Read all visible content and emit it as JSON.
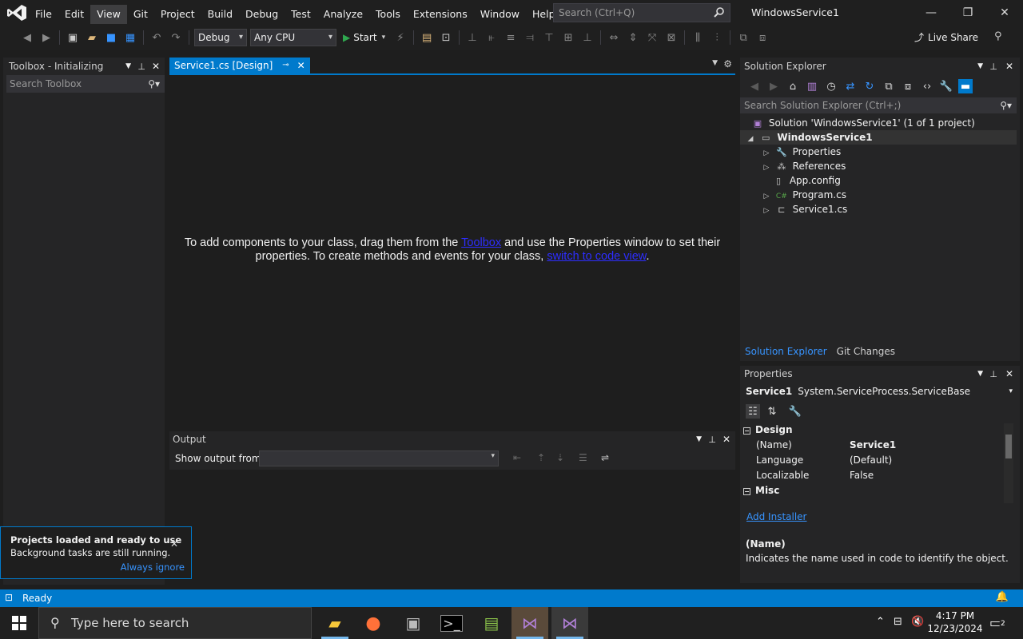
{
  "menu": [
    "File",
    "Edit",
    "View",
    "Git",
    "Project",
    "Build",
    "Debug",
    "Test",
    "Analyze",
    "Tools",
    "Extensions",
    "Window",
    "Help"
  ],
  "search_placeholder": "Search (Ctrl+Q)",
  "window_title": "WindowsService1",
  "toolbar": {
    "config": "Debug",
    "platform": "Any CPU",
    "start": "Start",
    "live_share": "Live Share"
  },
  "toolbox": {
    "title": "Toolbox - Initializing",
    "search_placeholder": "Search Toolbox"
  },
  "document": {
    "tab": "Service1.cs [Design]",
    "msg_a": "To add components to your class, drag them from the ",
    "link_toolbox": "Toolbox",
    "msg_b": " and use the Properties window to set their properties. To create methods and events for your class, ",
    "link_code": "switch to code view",
    "msg_c": "."
  },
  "output": {
    "title": "Output",
    "show_from": "Show output from:"
  },
  "solution_explorer": {
    "title": "Solution Explorer",
    "search_placeholder": "Search Solution Explorer (Ctrl+;)",
    "solution": "Solution 'WindowsService1' (1 of 1 project)",
    "project": "WindowsService1",
    "items": [
      "Properties",
      "References",
      "App.config",
      "Program.cs",
      "Service1.cs"
    ],
    "tab_active": "Solution Explorer",
    "tab_other": "Git Changes"
  },
  "properties": {
    "title": "Properties",
    "object_name": "Service1",
    "object_type": "System.ServiceProcess.ServiceBase",
    "cat_design": "Design",
    "rows": [
      {
        "name": "(Name)",
        "value": "Service1"
      },
      {
        "name": "Language",
        "value": "(Default)"
      },
      {
        "name": "Localizable",
        "value": "False"
      }
    ],
    "cat_misc": "Misc",
    "add_installer": "Add Installer",
    "desc_title": "(Name)",
    "desc_text": "Indicates the name used in code to identify the object."
  },
  "notification": {
    "title": "Projects loaded and ready to use",
    "subtitle": "Background tasks are still running.",
    "link": "Always ignore"
  },
  "status": "Ready",
  "taskbar": {
    "search_placeholder": "Type here to search",
    "time": "4:17 PM",
    "date": "12/23/2024",
    "notif_count": "2"
  }
}
